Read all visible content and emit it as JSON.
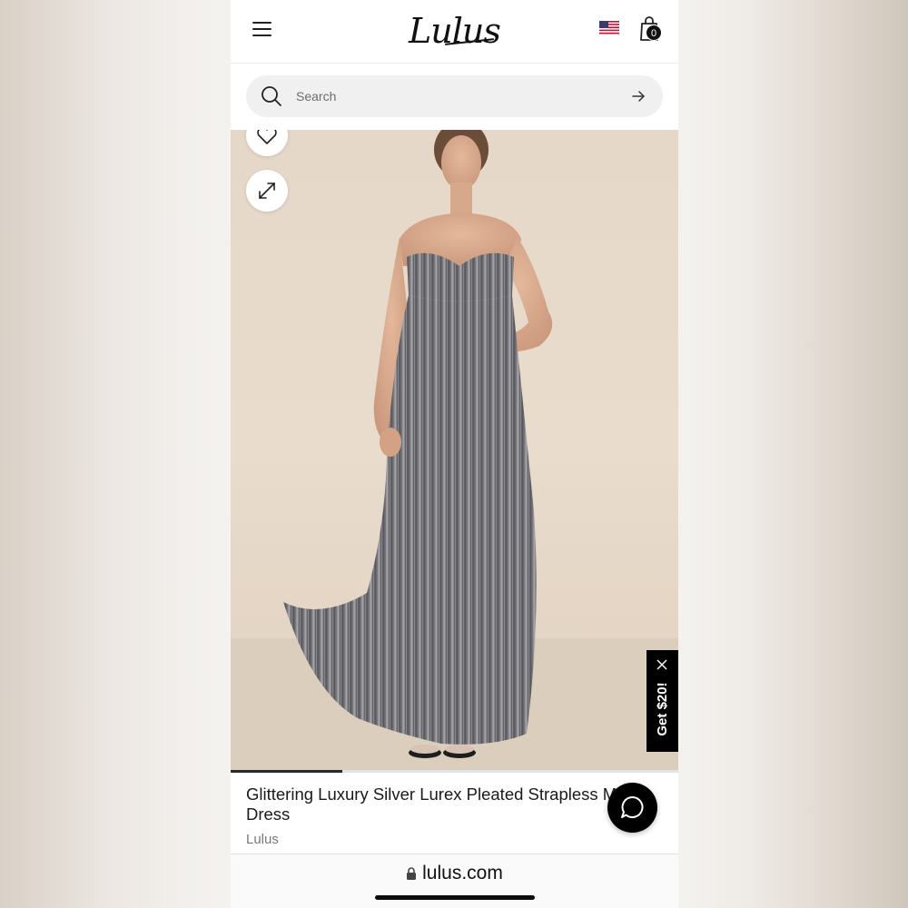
{
  "header": {
    "logo": "Lulus",
    "icons": {
      "menu": "hamburger-menu-icon",
      "flag": "us-flag-icon",
      "bag": "shopping-bag-icon"
    },
    "cart_count": "0"
  },
  "search": {
    "placeholder": "Search",
    "value": ""
  },
  "gallery": {
    "icons": {
      "wishlist": "heart-icon",
      "expand": "expand-icon"
    },
    "progress_fraction": 0.25
  },
  "promo": {
    "label": "Get $20!",
    "close_icon": "close-icon"
  },
  "product": {
    "title": "Glittering Luxury Silver Lurex Pleated Strapless Maxi Dress",
    "title_visible": "Glittering Luxury Silver Lurex Pleated Strapless M",
    "title_line2": "Dress",
    "brand": "Lulus"
  },
  "chat": {
    "icon": "chat-bubble-icon"
  },
  "browser": {
    "url": "lulus.com",
    "lock_icon": "lock-icon"
  },
  "colors": {
    "accent": "#000000",
    "search_bg": "#f0f0f0",
    "photo_bg": "#e6d8c8"
  }
}
